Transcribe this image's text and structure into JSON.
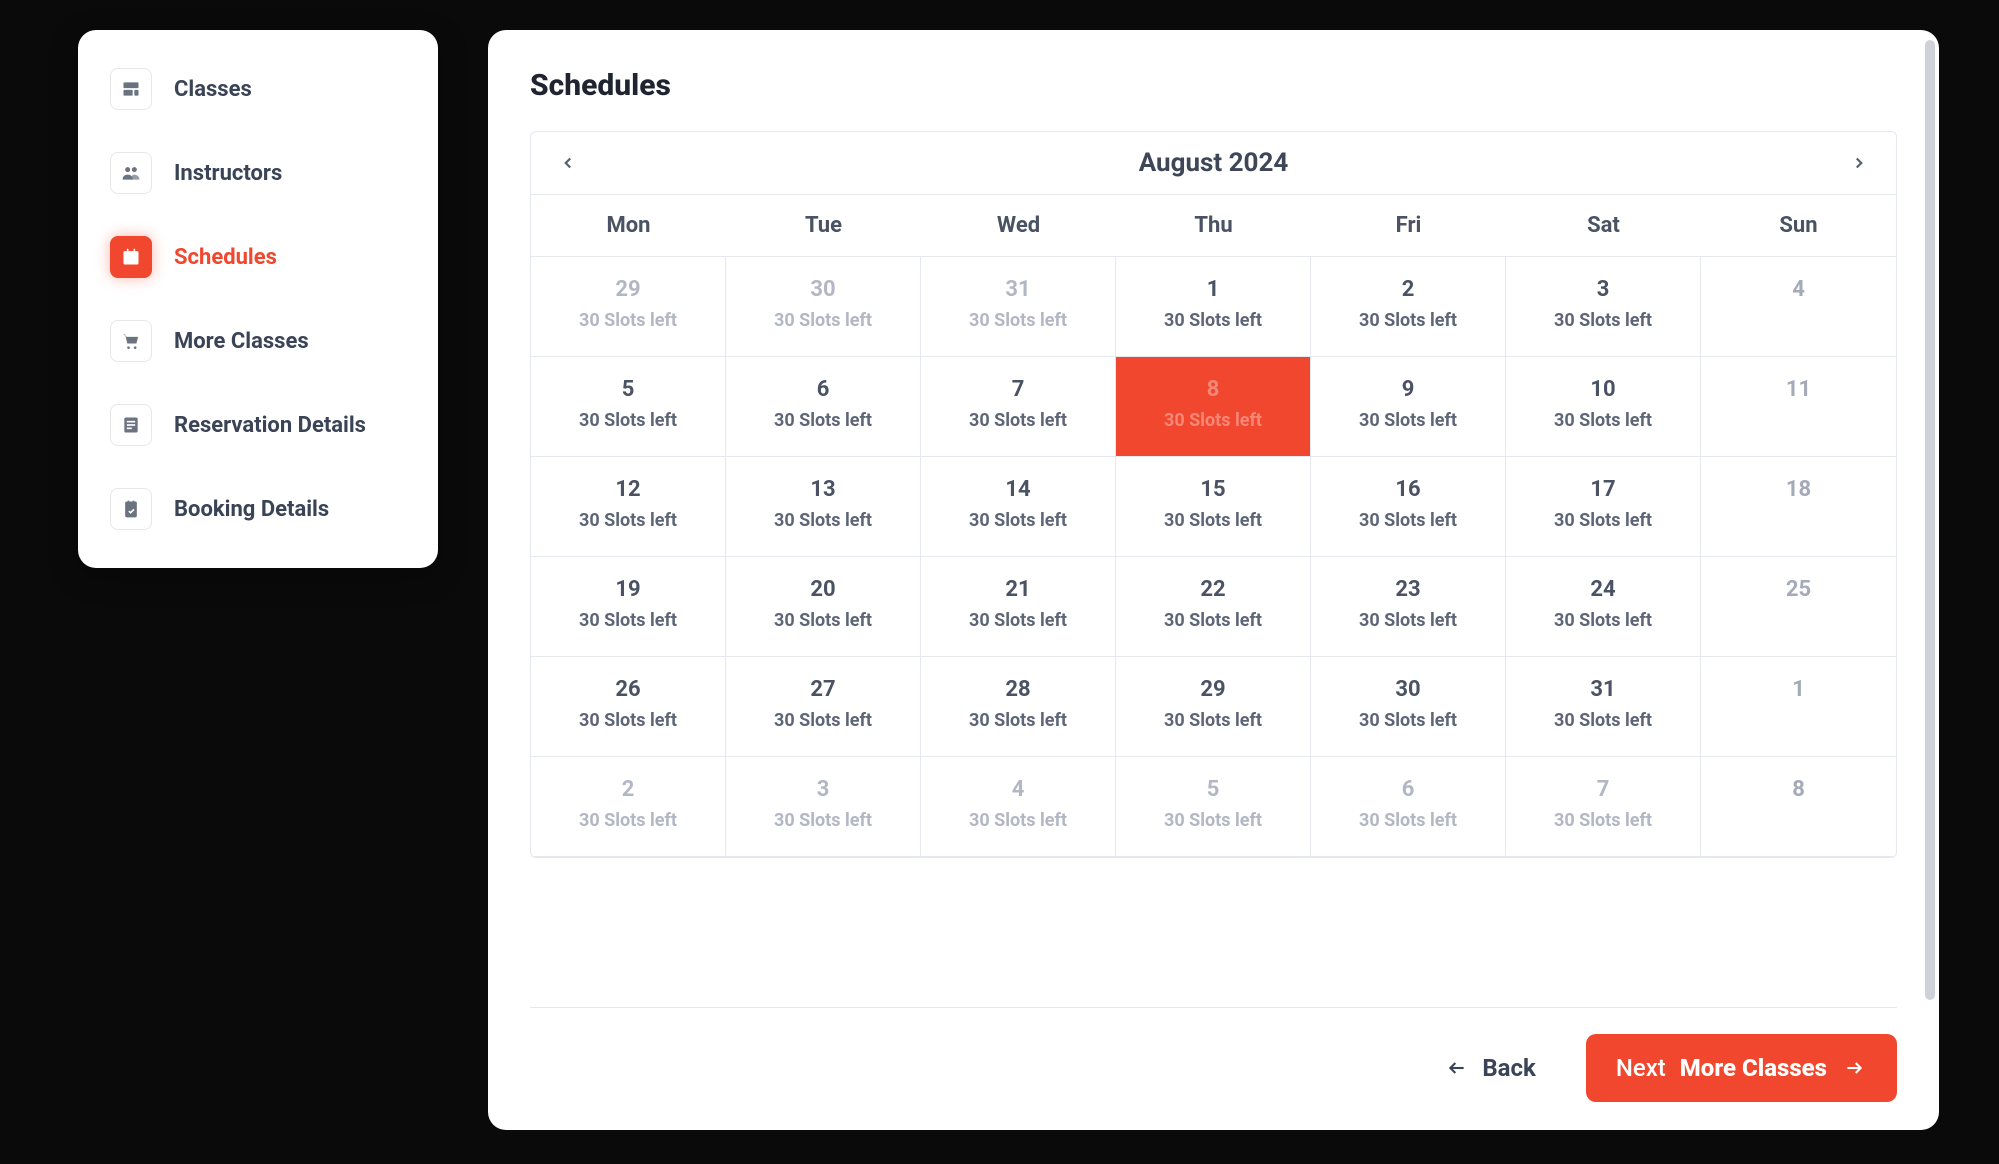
{
  "sidebar": {
    "items": [
      {
        "label": "Classes",
        "icon": "classes-icon",
        "active": false
      },
      {
        "label": "Instructors",
        "icon": "instructors-icon",
        "active": false
      },
      {
        "label": "Schedules",
        "icon": "schedules-icon",
        "active": true
      },
      {
        "label": "More Classes",
        "icon": "more-classes-icon",
        "active": false
      },
      {
        "label": "Reservation Details",
        "icon": "reservation-details-icon",
        "active": false
      },
      {
        "label": "Booking Details",
        "icon": "booking-details-icon",
        "active": false
      }
    ]
  },
  "main": {
    "title": "Schedules",
    "calendar": {
      "month_label": "August 2024",
      "day_names": [
        "Mon",
        "Tue",
        "Wed",
        "Thu",
        "Fri",
        "Sat",
        "Sun"
      ],
      "slot_label_template": "30 Slots left",
      "weeks": [
        [
          {
            "day": "29",
            "slots": "30 Slots left",
            "muted": true
          },
          {
            "day": "30",
            "slots": "30 Slots left",
            "muted": true
          },
          {
            "day": "31",
            "slots": "30 Slots left",
            "muted": true
          },
          {
            "day": "1",
            "slots": "30 Slots left"
          },
          {
            "day": "2",
            "slots": "30 Slots left"
          },
          {
            "day": "3",
            "slots": "30 Slots left"
          },
          {
            "day": "4",
            "weekend": true
          }
        ],
        [
          {
            "day": "5",
            "slots": "30 Slots left"
          },
          {
            "day": "6",
            "slots": "30 Slots left"
          },
          {
            "day": "7",
            "slots": "30 Slots left"
          },
          {
            "day": "8",
            "slots": "30 Slots left",
            "selected": true
          },
          {
            "day": "9",
            "slots": "30 Slots left"
          },
          {
            "day": "10",
            "slots": "30 Slots left"
          },
          {
            "day": "11",
            "weekend": true
          }
        ],
        [
          {
            "day": "12",
            "slots": "30 Slots left"
          },
          {
            "day": "13",
            "slots": "30 Slots left"
          },
          {
            "day": "14",
            "slots": "30 Slots left"
          },
          {
            "day": "15",
            "slots": "30 Slots left"
          },
          {
            "day": "16",
            "slots": "30 Slots left"
          },
          {
            "day": "17",
            "slots": "30 Slots left"
          },
          {
            "day": "18",
            "weekend": true
          }
        ],
        [
          {
            "day": "19",
            "slots": "30 Slots left"
          },
          {
            "day": "20",
            "slots": "30 Slots left"
          },
          {
            "day": "21",
            "slots": "30 Slots left"
          },
          {
            "day": "22",
            "slots": "30 Slots left"
          },
          {
            "day": "23",
            "slots": "30 Slots left"
          },
          {
            "day": "24",
            "slots": "30 Slots left"
          },
          {
            "day": "25",
            "weekend": true
          }
        ],
        [
          {
            "day": "26",
            "slots": "30 Slots left"
          },
          {
            "day": "27",
            "slots": "30 Slots left"
          },
          {
            "day": "28",
            "slots": "30 Slots left"
          },
          {
            "day": "29",
            "slots": "30 Slots left"
          },
          {
            "day": "30",
            "slots": "30 Slots left"
          },
          {
            "day": "31",
            "slots": "30 Slots left"
          },
          {
            "day": "1",
            "weekend": true
          }
        ],
        [
          {
            "day": "2",
            "slots": "30 Slots left",
            "muted": true
          },
          {
            "day": "3",
            "slots": "30 Slots left",
            "muted": true
          },
          {
            "day": "4",
            "slots": "30 Slots left",
            "muted": true
          },
          {
            "day": "5",
            "slots": "30 Slots left",
            "muted": true
          },
          {
            "day": "6",
            "slots": "30 Slots left",
            "muted": true
          },
          {
            "day": "7",
            "slots": "30 Slots left",
            "muted": true
          },
          {
            "day": "8",
            "weekend": true
          }
        ]
      ]
    },
    "footer": {
      "back_label": "Back",
      "next_prefix": "Next",
      "next_bold": "More Classes"
    }
  }
}
